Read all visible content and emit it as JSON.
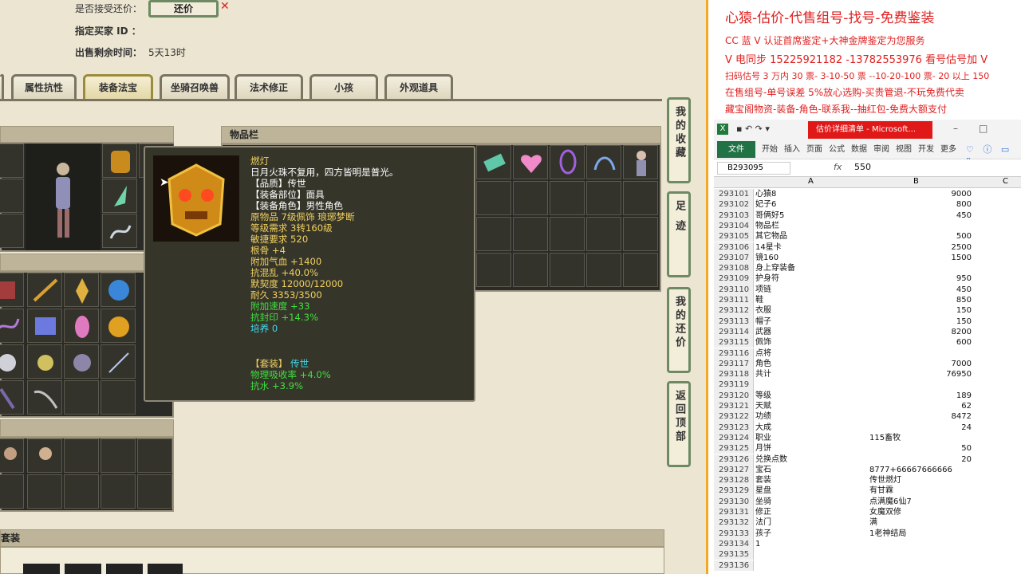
{
  "game": {
    "bargain_label": "是否接受还价：",
    "counter_button": "还价",
    "buyer_label": "指定买家 ID ：",
    "remaining_label": "出售剩余时间：",
    "remaining_value": "5天13时",
    "tabs": [
      "属性抗性",
      "装备法宝",
      "坐骑召唤兽",
      "法术修正",
      "小孩",
      "外观道具"
    ],
    "active_tab": "装备法宝",
    "inventory_title": "物品栏",
    "suits_title": "套装",
    "side_buttons": [
      "我的收藏",
      "足迹",
      "我的还价",
      "返回顶部"
    ]
  },
  "tooltip": {
    "name": "燃灯",
    "desc": "日月火珠不复用，四方皆明是普光。",
    "quality": "【品质】传世",
    "slot": "【装备部位】面具",
    "role": "【装备角色】男性角色",
    "origin": "原物品 7级佩饰 琅琊梦断",
    "level_req": "等级需求 3转160级",
    "agi_req": "敏捷要求 520",
    "stat1": "根骨 +4",
    "stat2": "附加气血 +1400",
    "stat3": "抗混乱 +40.0%",
    "stat4": "默契度 12000/12000",
    "stat5": "耐久 3353/3500",
    "stat6": "附加速度 +33",
    "stat7": "抗封印 +14.3%",
    "stat8": "培养 0",
    "suit_label": "【套装】",
    "suit_name": "传世",
    "suit1": "物理吸收率 +4.0%",
    "suit2": "抗水 +3.9%"
  },
  "ad": {
    "title": "心猿-估价-代售组号-找号-免费鉴装",
    "line1": "CC 蓝 V 认证首席鉴定+大神金牌鉴定为您服务",
    "line2": "V 电同步 15225921182 -13782553976 看号估号加 V",
    "line3": "扫码估号 3 万内 30 票- 3-10-50 票 --10-20-100 票- 20 以上 150",
    "line4": "在售组号-单号误差 5%放心选购-买贵管退-不玩免费代卖",
    "line5": "藏宝阁物资-装备-角色-联系我--抽红包-免费大额支付"
  },
  "excel": {
    "title": "估价详细清单 - Microsoft...",
    "ribbon_tabs": [
      "文件",
      "开始",
      "插入",
      "页面",
      "公式",
      "数据",
      "审阅",
      "视图",
      "开发",
      "更多"
    ],
    "name_box": "B293095",
    "formula": "550",
    "col_a": "A",
    "col_b": "B",
    "col_c": "C",
    "rows": [
      [
        "293101",
        "心猿8",
        "9000"
      ],
      [
        "293102",
        "妃子6",
        "800"
      ],
      [
        "293103",
        "哥俩好5",
        "450"
      ],
      [
        "293104",
        "物品栏",
        ""
      ],
      [
        "293105",
        "其它物品",
        "500"
      ],
      [
        "293106",
        "14星卡",
        "2500"
      ],
      [
        "293107",
        "镜160",
        "1500"
      ],
      [
        "293108",
        "身上穿装备",
        ""
      ],
      [
        "293109",
        "护身符",
        "950"
      ],
      [
        "293110",
        "项链",
        "450"
      ],
      [
        "293111",
        "鞋",
        "850"
      ],
      [
        "293112",
        "衣服",
        "150"
      ],
      [
        "293113",
        "帽子",
        "150"
      ],
      [
        "293114",
        "武器",
        "8200"
      ],
      [
        "293115",
        "佩饰",
        "600"
      ],
      [
        "293116",
        "点将",
        ""
      ],
      [
        "293117",
        "角色",
        "7000"
      ],
      [
        "293118",
        "共计",
        "76950"
      ],
      [
        "293119",
        "",
        ""
      ],
      [
        "293120",
        "等级",
        "189"
      ],
      [
        "293121",
        "天赋",
        "62"
      ],
      [
        "293122",
        "功绩",
        "8472"
      ],
      [
        "293123",
        "大成",
        "24"
      ],
      [
        "293124",
        "职业",
        "115畜牧"
      ],
      [
        "293125",
        "月饼",
        "50"
      ],
      [
        "293126",
        "兑换点数",
        "20"
      ],
      [
        "293127",
        "宝石",
        "8777+66667666666"
      ],
      [
        "293128",
        "套装",
        "传世燃灯"
      ],
      [
        "293129",
        "星盘",
        "有甘霖"
      ],
      [
        "293130",
        "坐骑",
        "点满魔6仙7"
      ],
      [
        "293131",
        "修正",
        "女魔双修"
      ],
      [
        "293132",
        "法门",
        "满"
      ],
      [
        "293133",
        "孩子",
        "1老神结局"
      ],
      [
        "293134",
        "1",
        ""
      ],
      [
        "293135",
        "",
        ""
      ],
      [
        "293136",
        "",
        ""
      ]
    ]
  }
}
